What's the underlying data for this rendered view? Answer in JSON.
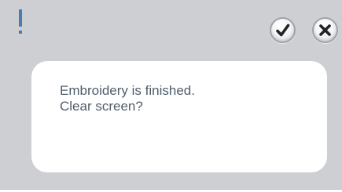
{
  "dialog": {
    "alert_symbol": "!",
    "message_lines": [
      "Embroidery is finished.",
      "Clear screen?"
    ],
    "icons": {
      "alert": "exclamation-icon",
      "confirm": "checkmark-icon",
      "cancel": "close-x-icon"
    },
    "colors": {
      "panel_background": "#cdcfd2",
      "message_background": "#ffffff",
      "accent_blue": "#4a7cae",
      "text": "#4f5d6b"
    }
  }
}
